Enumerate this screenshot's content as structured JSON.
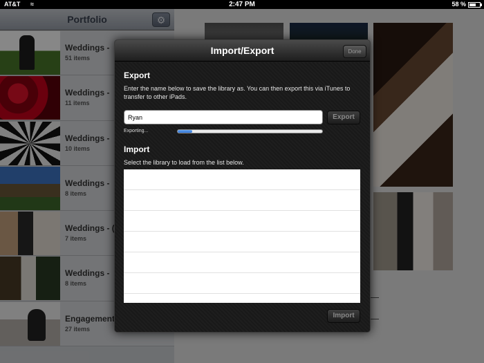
{
  "status_bar": {
    "carrier": "AT&T",
    "time": "2:47 PM",
    "battery_percent": "58 %",
    "battery_level": 0.58
  },
  "sidebar": {
    "title": "Portfolio",
    "settings_icon": "gear-icon",
    "albums": [
      {
        "name": "Weddings -",
        "count": "51 items"
      },
      {
        "name": "Weddings -",
        "count": "11 items"
      },
      {
        "name": "Weddings -",
        "count": "10 items"
      },
      {
        "name": "Weddings - ",
        "count": "8 items"
      },
      {
        "name": "Weddings - (",
        "count": "7 items"
      },
      {
        "name": "Weddings -",
        "count": "8 items"
      },
      {
        "name": "Engagement",
        "count": "27 items"
      }
    ]
  },
  "modal": {
    "title": "Import/Export",
    "done_label": "Done",
    "export": {
      "heading": "Export",
      "description": "Enter the name below to save the library as. You can then export this via iTunes to transfer to other iPads.",
      "input_value": "Ryan",
      "button_label": "Export",
      "progress_label": "Exporting...",
      "progress": 0.1
    },
    "import": {
      "heading": "Import",
      "description": "Select the library to load from the list below.",
      "libraries": [
        "",
        "",
        "",
        "",
        "",
        ""
      ],
      "button_label": "Import"
    }
  },
  "colors": {
    "progress_fill": "#2a6fd3",
    "modal_background": "#1b1b1b"
  }
}
